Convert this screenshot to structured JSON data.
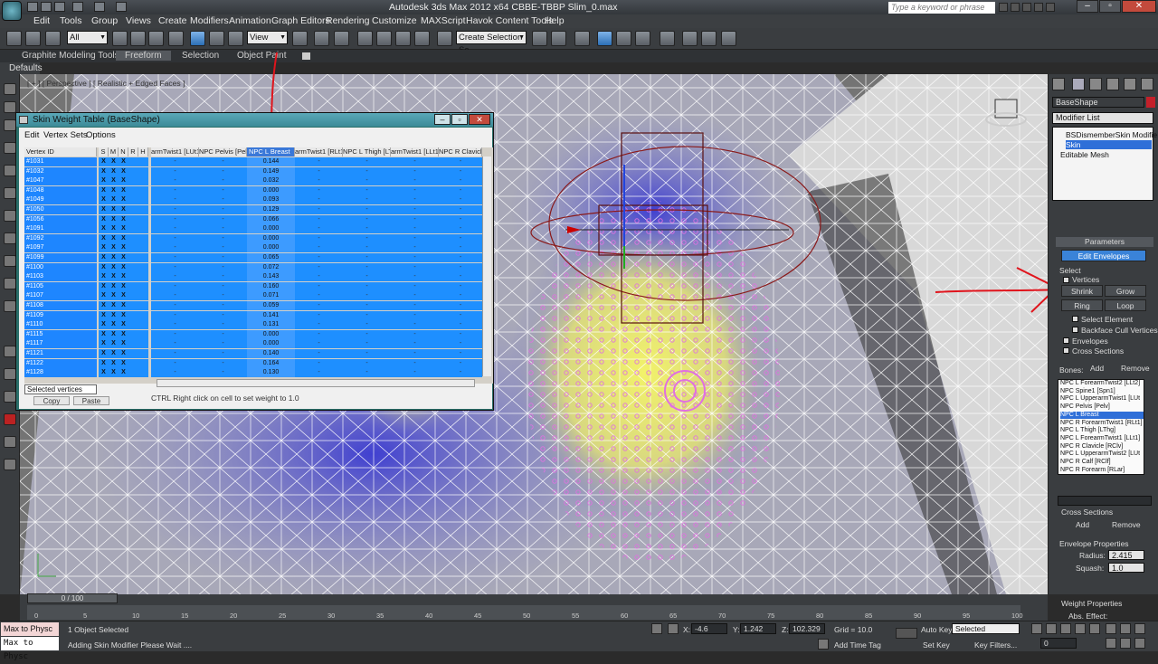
{
  "app": {
    "title": "Autodesk 3ds Max 2012 x64      CBBE-TBBP Slim_0.max",
    "search_placeholder": "Type a keyword or phrase"
  },
  "menu": [
    "Edit",
    "Tools",
    "Group",
    "Views",
    "Create",
    "Modifiers",
    "Animation",
    "Graph Editors",
    "Rendering",
    "Customize",
    "MAXScript",
    "Havok Content Tools",
    "Help"
  ],
  "toolbar": {
    "selection_filter": "All",
    "ref_coord": "View",
    "named_selection": "Create Selection Se"
  },
  "ribbon": {
    "tabs": [
      "Graphite Modeling Tools",
      "Freeform",
      "Selection",
      "Object Paint"
    ],
    "active": "Freeform",
    "defaults_label": "Defaults"
  },
  "viewport": {
    "label": "[ + ] [ Perspective ] [ Realistic + Edged Faces ]"
  },
  "skin_dialog": {
    "title": "Skin Weight Table (BaseShape)",
    "menu": [
      "Edit",
      "Vertex Sets",
      "Options"
    ],
    "columns": [
      "Vertex ID",
      "S",
      "M",
      "N",
      "R",
      "H",
      "armTwist1 [LUt1]",
      "NPC Pelvis [Pelv]",
      "NPC L Breast",
      "armTwist1 [RLt1]",
      "NPC L Thigh [LThg]",
      "armTwist1 [LLt1]",
      "NPC R Clavicle [R"
    ],
    "selected_column": "NPC L Breast",
    "rows": [
      {
        "id": "#1031",
        "v": "0.144"
      },
      {
        "id": "#1032",
        "v": "0.149"
      },
      {
        "id": "#1047",
        "v": "0.032"
      },
      {
        "id": "#1048",
        "v": "0.000"
      },
      {
        "id": "#1049",
        "v": "0.093"
      },
      {
        "id": "#1050",
        "v": "0.129"
      },
      {
        "id": "#1056",
        "v": "0.066"
      },
      {
        "id": "#1091",
        "v": "0.000"
      },
      {
        "id": "#1092",
        "v": "0.000"
      },
      {
        "id": "#1097",
        "v": "0.000"
      },
      {
        "id": "#1099",
        "v": "0.065"
      },
      {
        "id": "#1100",
        "v": "0.072"
      },
      {
        "id": "#1103",
        "v": "0.143"
      },
      {
        "id": "#1105",
        "v": "0.160"
      },
      {
        "id": "#1107",
        "v": "0.071"
      },
      {
        "id": "#1108",
        "v": "0.059"
      },
      {
        "id": "#1109",
        "v": "0.141"
      },
      {
        "id": "#1110",
        "v": "0.131"
      },
      {
        "id": "#1115",
        "v": "0.000"
      },
      {
        "id": "#1117",
        "v": "0.000"
      },
      {
        "id": "#1121",
        "v": "0.140"
      },
      {
        "id": "#1122",
        "v": "0.164"
      },
      {
        "id": "#1128",
        "v": "0.130"
      }
    ],
    "x_mark": "X",
    "dash": "-",
    "selection_mode": "Selected vertices",
    "copy_label": "Copy",
    "paste_label": "Paste",
    "hint": "CTRL Right click on cell to set weight to 1.0"
  },
  "command_panel": {
    "object_name": "BaseShape",
    "modifier_list_label": "Modifier List",
    "stack": [
      "BSDismemberSkin Modifie",
      "Skin",
      "Editable Mesh"
    ],
    "stack_selected": "Skin",
    "parameters_label": "Parameters",
    "edit_envelopes": "Edit Envelopes",
    "select_label": "Select",
    "vertices_label": "Vertices",
    "shrink": "Shrink",
    "grow": "Grow",
    "ring": "Ring",
    "loop": "Loop",
    "select_element": "Select Element",
    "backface": "Backface Cull Vertices",
    "envelopes": "Envelopes",
    "cross_sections": "Cross Sections",
    "bones_label": "Bones:",
    "add": "Add",
    "remove": "Remove",
    "bones": [
      "NPC L ForearmTwist2 [LLt2]",
      "NPC Spine1 [Spn1]",
      "NPC L UpperarmTwist1 [LUt",
      "NPC Pelvis [Pelv]",
      "NPC L Breast",
      "NPC R ForearmTwist1 [RLt1]",
      "NPC L Thigh [LThg]",
      "NPC L ForearmTwist1 [LLt1]",
      "NPC R Clavicle [RClv]",
      "NPC L UpperarmTwist2 [LUt",
      "NPC R Calf [RClf]",
      "NPC R Forearm [RLar]"
    ],
    "bones_selected": "NPC L Breast",
    "cross_sections_header": "Cross Sections",
    "envelope_props": "Envelope Properties",
    "radius_label": "Radius:",
    "radius_value": "2.415",
    "squash_label": "Squash:",
    "squash_value": "1.0",
    "weight_props": "Weight Properties",
    "abs_effect": "Abs. Effect:"
  },
  "timeline": {
    "frame": "0 / 100",
    "ticks": [
      "0",
      "5",
      "10",
      "15",
      "20",
      "25",
      "30",
      "35",
      "40",
      "45",
      "50",
      "55",
      "60",
      "65",
      "70",
      "75",
      "80",
      "85",
      "90",
      "95",
      "100"
    ]
  },
  "status": {
    "maxscript_line1": "Max to Physc",
    "maxscript_line2": "Max to Physc",
    "objects_selected": "1 Object Selected",
    "prompt": "Adding Skin Modifier Please Wait ....",
    "x_label": "X:",
    "x": "-4.6",
    "y_label": "Y:",
    "y": "1.242",
    "z_label": "Z:",
    "z": "102.329",
    "grid": "Grid = 10.0",
    "add_time_tag": "Add Time Tag",
    "auto_key": "Auto Key",
    "set_key": "Set Key",
    "key_mode": "Selected",
    "key_filters": "Key Filters...",
    "frame_field": "0"
  },
  "colors": {
    "annotation": "#e0141c",
    "selection_blue": "#1e8fff",
    "envelope_pink": "#e070e0"
  }
}
